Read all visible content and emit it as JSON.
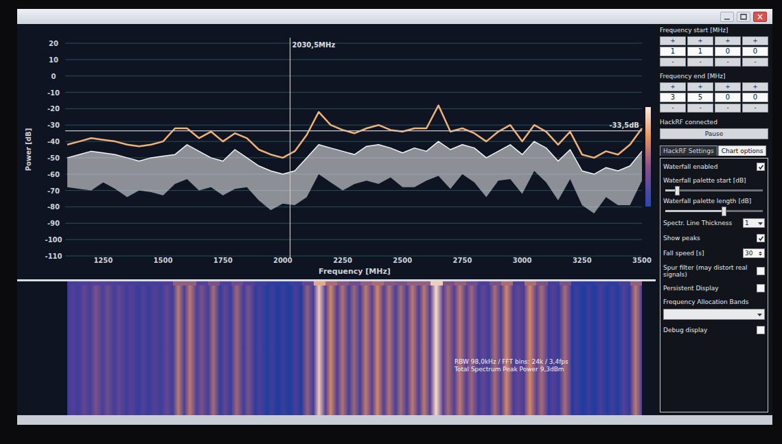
{
  "chart": {
    "y_axis_title": "Power [dB]",
    "x_axis_title": "Frequency [MHz]",
    "freq_start": 1100,
    "freq_end": 3500,
    "db_max": 20,
    "db_min": -110,
    "y_ticks": [
      "20",
      "10",
      "0",
      "-10",
      "-20",
      "-30",
      "-40",
      "-50",
      "-60",
      "-70",
      "-80",
      "-90",
      "-100",
      "-110"
    ],
    "x_ticks": [
      "1250",
      "1500",
      "1750",
      "2000",
      "2250",
      "2500",
      "2750",
      "3000",
      "3250",
      "3500"
    ],
    "cursor": {
      "freq": 2030.5,
      "label": "2030,5MHz",
      "level_db": -33.5,
      "level_label": "-33,5dB"
    },
    "series": [
      {
        "name": "peaks",
        "color": "#f1b27a",
        "values": [
          -42,
          -40,
          -38,
          -39,
          -40,
          -42,
          -43,
          -42,
          -40,
          -32,
          -32,
          -38,
          -34,
          -40,
          -35,
          -38,
          -45,
          -48,
          -50,
          -46,
          -36,
          -22,
          -30,
          -33,
          -35,
          -32,
          -30,
          -33,
          -34,
          -32,
          -32,
          -18,
          -34,
          -32,
          -35,
          -40,
          -34,
          -30,
          -40,
          -30,
          -34,
          -42,
          -34,
          -48,
          -50,
          -46,
          -48,
          -42,
          -32
        ]
      },
      {
        "name": "spectrum",
        "color": "#f4f4f4",
        "values": [
          -50,
          -48,
          -46,
          -47,
          -48,
          -50,
          -52,
          -50,
          -49,
          -48,
          -42,
          -46,
          -50,
          -52,
          -45,
          -50,
          -55,
          -58,
          -60,
          -58,
          -50,
          -42,
          -44,
          -46,
          -48,
          -43,
          -42,
          -44,
          -47,
          -44,
          -46,
          -40,
          -45,
          -42,
          -44,
          -50,
          -46,
          -42,
          -48,
          -40,
          -44,
          -52,
          -45,
          -58,
          -60,
          -56,
          -58,
          -55,
          -46
        ]
      }
    ]
  },
  "waterfall": {
    "info": [
      "RBW 98,0kHz / FFT bins: 24k / 3,4fps",
      "Total Spectrum Peak Power 9,3dBm"
    ]
  },
  "panel": {
    "freq_start": {
      "label": "Frequency start [MHz]",
      "digits": [
        {
          "up": "+",
          "value": "1",
          "down": "-"
        },
        {
          "up": "+",
          "value": "1",
          "down": "-"
        },
        {
          "up": "+",
          "value": "0",
          "down": "-"
        },
        {
          "up": "+",
          "value": "0",
          "down": "-"
        }
      ]
    },
    "freq_end": {
      "label": "Frequency end [MHz]",
      "digits": [
        {
          "up": "+",
          "value": "3",
          "down": "-"
        },
        {
          "up": "+",
          "value": "5",
          "down": "-"
        },
        {
          "up": "+",
          "value": "0",
          "down": "-"
        },
        {
          "up": "+",
          "value": "0",
          "down": "-"
        }
      ]
    },
    "status": "HackRF connected",
    "pause_button": "Pause",
    "tabs": [
      {
        "label": "HackRF Settings",
        "selected": false
      },
      {
        "label": "Chart options",
        "selected": true
      }
    ],
    "options": [
      {
        "kind": "checkbox",
        "label": "Waterfall enabled",
        "checked": true
      },
      {
        "kind": "slider",
        "label": "Waterfall palette start [dB]",
        "level": 0.12
      },
      {
        "kind": "slider",
        "label": "Waterfall palette length [dB]",
        "level": 0.6
      },
      {
        "kind": "select",
        "label": "Spectr. Line Thickness",
        "value": "1"
      },
      {
        "kind": "checkbox",
        "label": "Show peaks",
        "checked": true
      },
      {
        "kind": "spin",
        "label": "Fall speed [s]",
        "value": "30"
      },
      {
        "kind": "checkbox",
        "label": "Spur filter (may distort real signals)",
        "checked": false
      },
      {
        "kind": "checkbox",
        "label": "Persistent Display",
        "checked": false
      },
      {
        "kind": "wideselect",
        "label": "Frequency Allocation Bands",
        "value": ""
      },
      {
        "kind": "checkbox",
        "label": "Debug display",
        "checked": false
      }
    ]
  }
}
